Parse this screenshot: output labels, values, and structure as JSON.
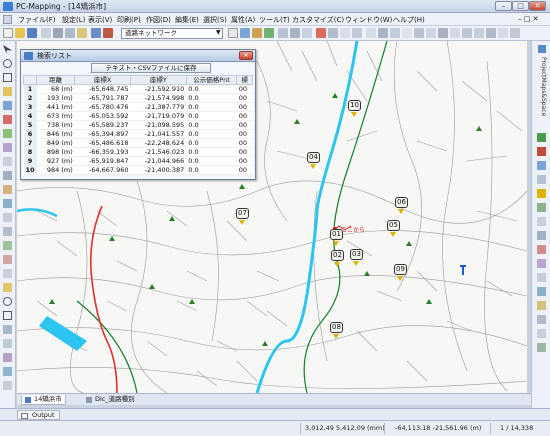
{
  "window": {
    "title": "PC-Mapping - [14矯浜市]"
  },
  "menu": [
    "ファイル(F)",
    "設定(L)",
    "表示(V)",
    "印刷(P)",
    "作図(D)",
    "編集(E)",
    "選択(S)",
    "属性(A)",
    "ツール(T)",
    "カスタマイズ(C)",
    "ウィンドウ(W)",
    "ヘルプ(H)"
  ],
  "toolbar": {
    "layer_select": "道路ネットワーク"
  },
  "right_panel_label": "ProjectMaps&Space",
  "search_window": {
    "title": "検索リスト",
    "save_button": "テキスト・CSVファイルに保存",
    "columns": [
      "",
      "距離",
      "座標X",
      "座標Y",
      "公示価格Pnt",
      "標"
    ],
    "rows": [
      [
        "1",
        "68 (m)",
        "-65,648.745",
        "-21,592.910",
        "0.0",
        "00"
      ],
      [
        "2",
        "193 (m)",
        "-65,791.787",
        "-21,574.998",
        "0.0",
        "00"
      ],
      [
        "3",
        "441 (m)",
        "-65,780.476",
        "-21,387.779",
        "0.0",
        "00"
      ],
      [
        "4",
        "673 (m)",
        "-65,053.592",
        "-21,719.079",
        "0.0",
        "00"
      ],
      [
        "5",
        "738 (m)",
        "-65,589.237",
        "-21,098.595",
        "0.0",
        "00"
      ],
      [
        "6",
        "846 (m)",
        "-65,394.897",
        "-21,041.557",
        "0.0",
        "00"
      ],
      [
        "7",
        "849 (m)",
        "-65,486.618",
        "-22,248.624",
        "0.0",
        "00"
      ],
      [
        "8",
        "898 (m)",
        "-66,359.193",
        "-21,546.023",
        "0.0",
        "00"
      ],
      [
        "9",
        "927 (m)",
        "-65,919.847",
        "-21,044.966",
        "0.0",
        "00"
      ],
      [
        "10",
        "984 (m)",
        "-64,667.960",
        "-21,400.387",
        "0.0",
        "00"
      ]
    ]
  },
  "map": {
    "markers": [
      "01",
      "02",
      "03",
      "04",
      "05",
      "06",
      "07",
      "08",
      "09",
      "10"
    ],
    "search_point_label": "ここから"
  },
  "tabs": [
    "14矯浜市",
    "Dic_道路種別"
  ],
  "output_tab": "Output",
  "status": {
    "coords_mm": "3,012.49 5,412.09 (mm)",
    "coords_world": "-64,113.18 -21,561.96 (m)",
    "page": "1 / 14,338"
  },
  "colors": {
    "river": "#2ec4f0",
    "highway": "#e03030",
    "railway": "#1a7a2a",
    "marker_flag": "#d9b400"
  }
}
